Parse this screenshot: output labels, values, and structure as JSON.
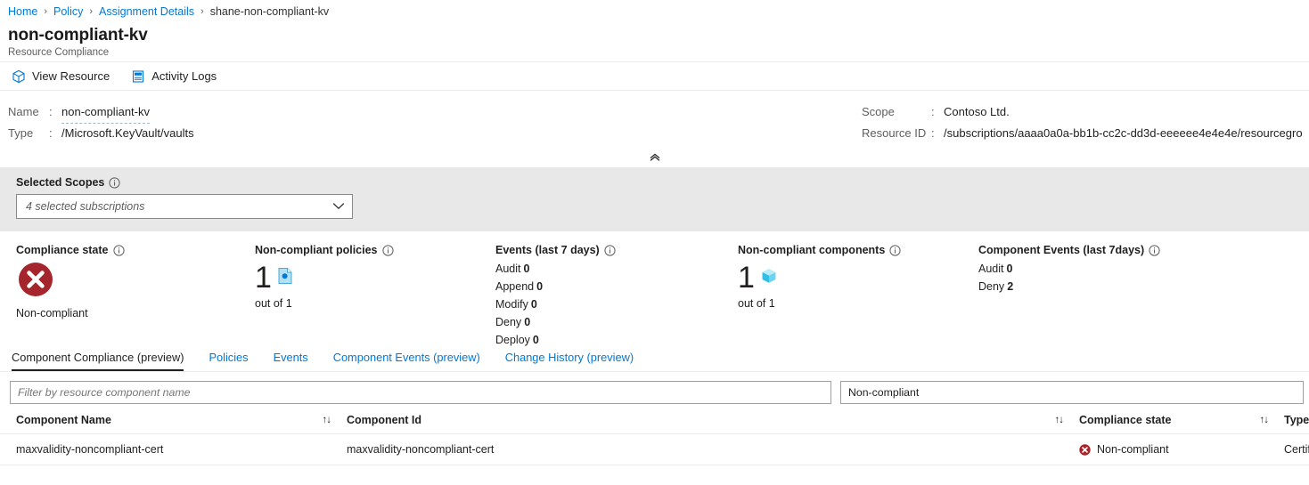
{
  "breadcrumb": {
    "items": [
      {
        "label": "Home",
        "link": true
      },
      {
        "label": "Policy",
        "link": true
      },
      {
        "label": "Assignment Details",
        "link": true
      },
      {
        "label": "shane-non-compliant-kv",
        "link": false
      }
    ],
    "separator": "›"
  },
  "header": {
    "title": "non-compliant-kv",
    "subtitle": "Resource Compliance"
  },
  "commandbar": {
    "items": [
      {
        "label": "View Resource",
        "icon": "cube-icon"
      },
      {
        "label": "Activity Logs",
        "icon": "activity-log-icon"
      }
    ]
  },
  "properties": {
    "left": [
      {
        "label": "Name",
        "colon": ":",
        "value": "non-compliant-kv",
        "link": true
      },
      {
        "label": "Type",
        "colon": ":",
        "value": "/Microsoft.KeyVault/vaults",
        "link": false
      }
    ],
    "right": [
      {
        "label": "Scope",
        "colon": ":",
        "value": "Contoso Ltd."
      },
      {
        "label": "Resource ID",
        "colon": ":",
        "value": "/subscriptions/aaaa0a0a-bb1b-cc2c-dd3d-eeeeee4e4e4e/resourcegro"
      }
    ],
    "collapse_icon": "chevron-double-up-icon"
  },
  "scopes": {
    "label": "Selected Scopes",
    "info_icon": "info-icon",
    "selected_value": "4 selected subscriptions",
    "chevron_icon": "chevron-down-icon"
  },
  "summary": {
    "compliance_state": {
      "title": "Compliance state",
      "info_icon": "info-icon",
      "status_icon": "error-circle-icon",
      "status_label": "Non-compliant",
      "status_color": "#a4262c"
    },
    "noncompliant_policies": {
      "title": "Non-compliant policies",
      "info_icon": "info-icon",
      "count": "1",
      "icon": "policy-document-icon",
      "out_of": "out of 1"
    },
    "events": {
      "title": "Events (last 7 days)",
      "info_icon": "info-icon",
      "rows": [
        {
          "label": "Audit",
          "value": "0"
        },
        {
          "label": "Append",
          "value": "0"
        },
        {
          "label": "Modify",
          "value": "0"
        },
        {
          "label": "Deny",
          "value": "0"
        },
        {
          "label": "Deploy",
          "value": "0"
        }
      ]
    },
    "noncompliant_components": {
      "title": "Non-compliant components",
      "info_icon": "info-icon",
      "count": "1",
      "icon": "component-cube-icon",
      "out_of": "out of 1"
    },
    "component_events": {
      "title": "Component Events (last 7days)",
      "info_icon": "info-icon",
      "rows": [
        {
          "label": "Audit",
          "value": "0"
        },
        {
          "label": "Deny",
          "value": "2"
        }
      ]
    }
  },
  "tabs": [
    {
      "label": "Component Compliance (preview)",
      "active": true
    },
    {
      "label": "Policies",
      "active": false
    },
    {
      "label": "Events",
      "active": false
    },
    {
      "label": "Component Events (preview)",
      "active": false
    },
    {
      "label": "Change History (preview)",
      "active": false
    }
  ],
  "filters": {
    "name_placeholder": "Filter by resource component name",
    "name_value": "",
    "state_value": "Non-compliant"
  },
  "table": {
    "columns": [
      {
        "label": "Component Name",
        "sortable": true,
        "sort_icon": "sort-updown-icon"
      },
      {
        "label": "Component Id",
        "sortable": true,
        "sort_icon": "sort-updown-icon"
      },
      {
        "label": "Compliance state",
        "sortable": true,
        "sort_icon": "sort-updown-icon"
      },
      {
        "label": "Type",
        "sortable": false,
        "sort_icon": ""
      }
    ],
    "rows": [
      {
        "component_name": "maxvalidity-noncompliant-cert",
        "component_id": "maxvalidity-noncompliant-cert",
        "compliance_state": "Non-compliant",
        "compliance_icon": "error-circle-small-icon",
        "type": "Certif"
      }
    ]
  }
}
